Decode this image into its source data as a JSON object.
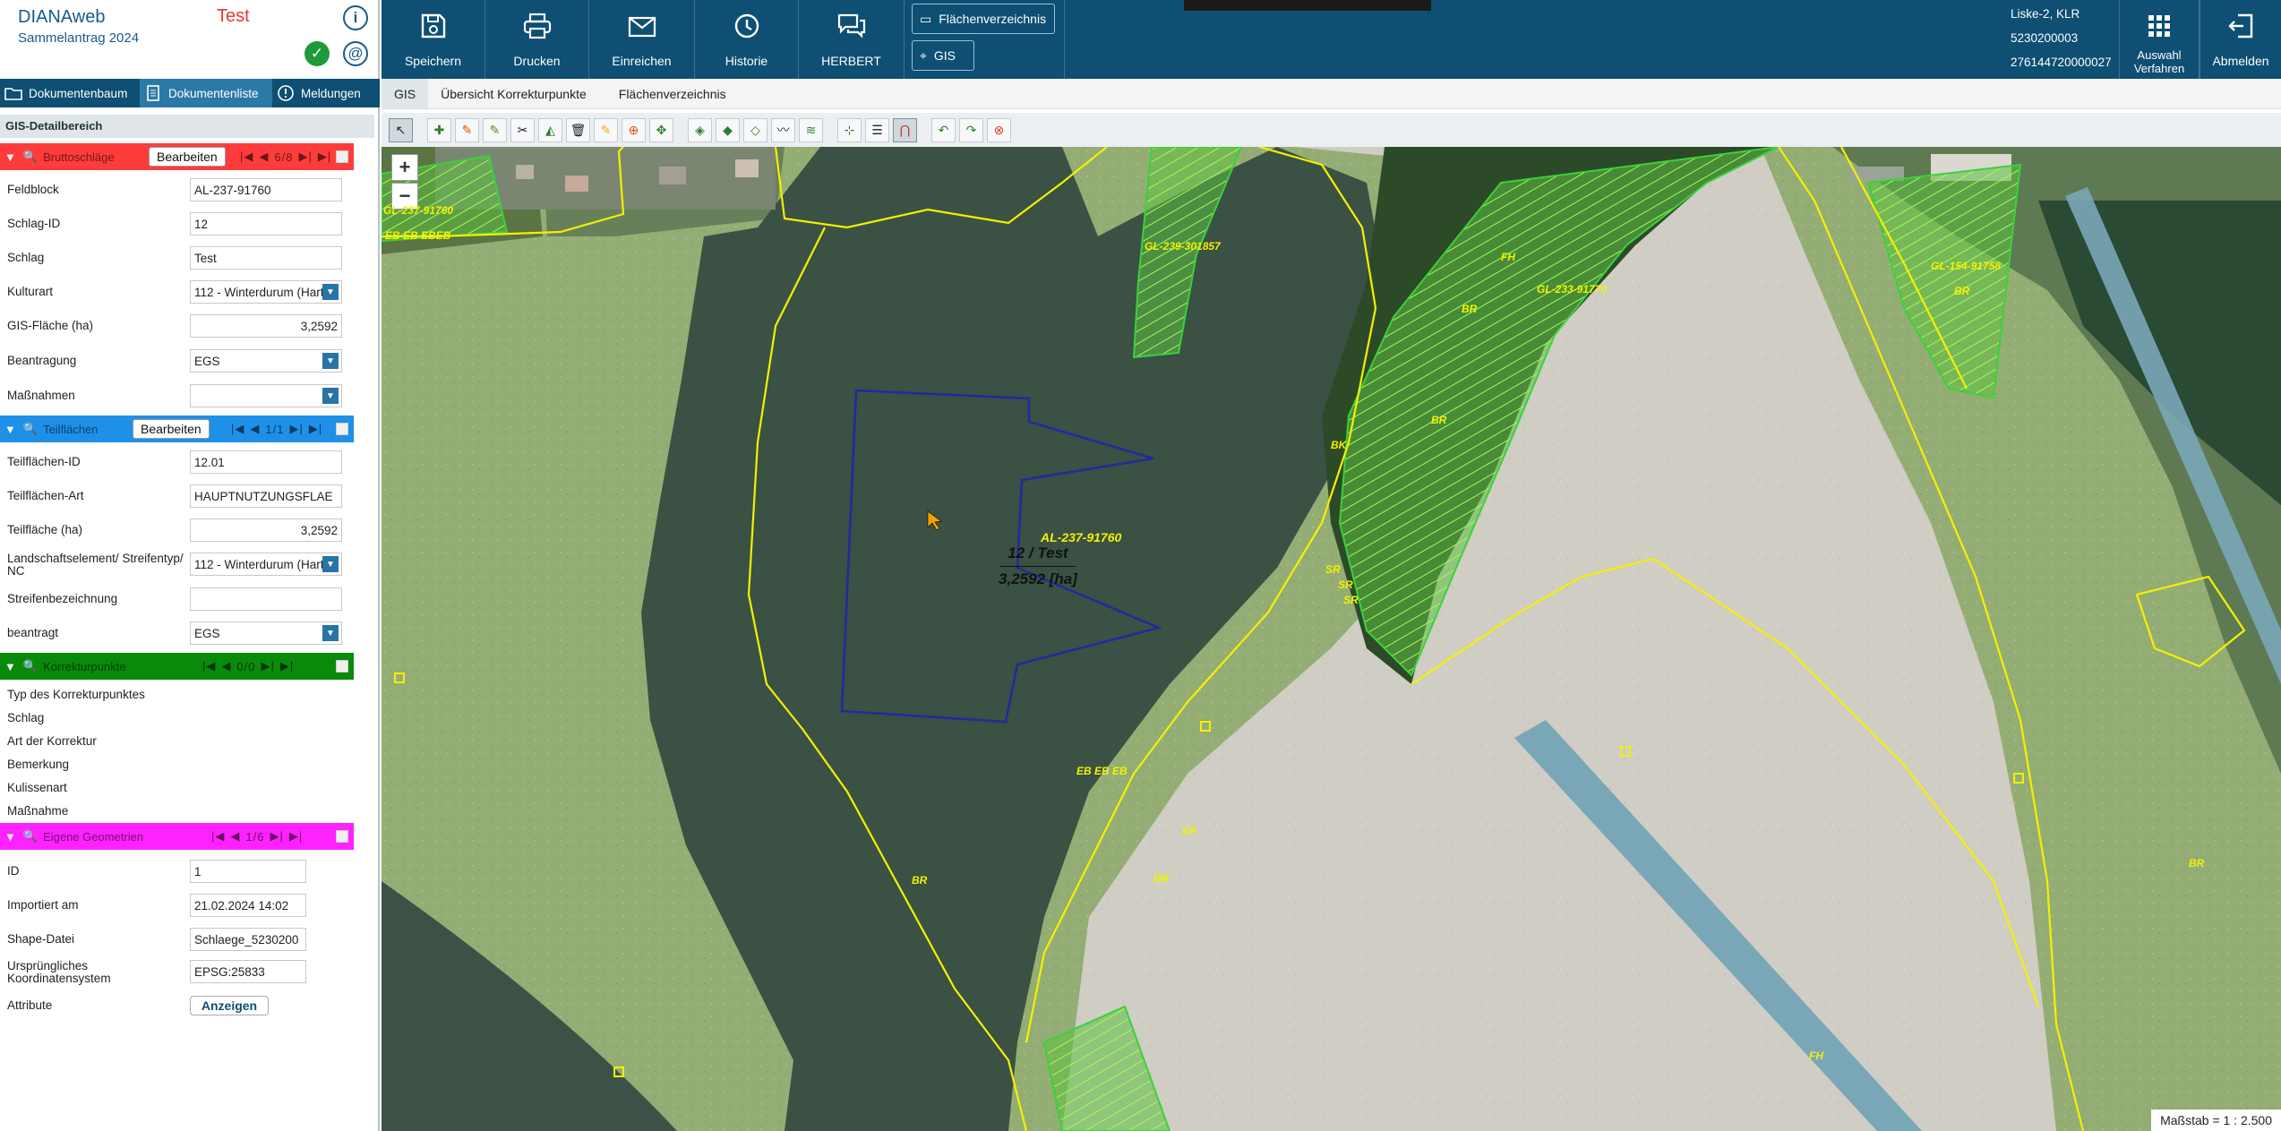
{
  "app": {
    "name": "DIANAweb",
    "subtitle": "Sammelantrag 2024",
    "status_text": "Test"
  },
  "left_tabs": [
    {
      "label": "Dokumentenbaum",
      "icon": "folder-icon"
    },
    {
      "label": "Dokumentenliste",
      "icon": "document-list-icon"
    },
    {
      "label": "Meldungen",
      "icon": "alert-icon"
    }
  ],
  "detail_title": "GIS-Detailbereich",
  "brutto": {
    "title": "Bruttoschläge",
    "edit": "Bearbeiten",
    "nav": "6/8",
    "color": "#ff3c3c",
    "fields": [
      {
        "label": "Feldblock",
        "value": "AL-237-91760"
      },
      {
        "label": "Schlag-ID",
        "value": "12"
      },
      {
        "label": "Schlag",
        "value": "Test"
      },
      {
        "label": "Kulturart",
        "value": "112 - Winterdurum (Hart"
      },
      {
        "label": "GIS-Fläche (ha)",
        "value": "3,2592"
      },
      {
        "label": "Beantragung",
        "value": "EGS"
      },
      {
        "label": "Maßnahmen",
        "value": ""
      }
    ]
  },
  "teil": {
    "title": "Teilflächen",
    "edit": "Bearbeiten",
    "nav": "1/1",
    "color": "#1e90e8",
    "fields": [
      {
        "label": "Teilflächen-ID",
        "value": "12.01"
      },
      {
        "label": "Teilflächen-Art",
        "value": "HAUPTNUTZUNGSFLAE"
      },
      {
        "label": "Teilfläche (ha)",
        "value": "3,2592"
      },
      {
        "label": "Landschaftselement/ Streifentyp/ NC",
        "value": "112 - Winterdurum (Hart"
      },
      {
        "label": "Streifenbezeichnung",
        "value": ""
      },
      {
        "label": "beantragt",
        "value": "EGS"
      }
    ]
  },
  "korr": {
    "title": "Korrekturpunkte",
    "nav": "0/0",
    "color": "#0a8a0a",
    "fields": [
      "Typ des Korrekturpunktes",
      "Schlag",
      "Art der Korrektur",
      "Bemerkung",
      "Kulissenart",
      "Maßnahme"
    ]
  },
  "eigene": {
    "title": "Eigene Geometrien",
    "nav": "1/6",
    "color": "#ff22ff",
    "fields": [
      {
        "label": "ID",
        "value": "1"
      },
      {
        "label": "Importiert am",
        "value": "21.02.2024 14:02"
      },
      {
        "label": "Shape-Datei",
        "value": "Schlaege_5230200"
      },
      {
        "label": "Ursprüngliches Koordinatensystem",
        "value": "EPSG:25833"
      },
      {
        "label": "Attribute",
        "value": "Anzeigen"
      }
    ]
  },
  "toolbar": {
    "save": "Speichern",
    "print": "Drucken",
    "submit": "Einreichen",
    "history": "Historie",
    "herbert": "HERBERT",
    "fv": "Flächenverzeichnis",
    "gis": "GIS",
    "auswahl_1": "Auswahl",
    "auswahl_2": "Verfahren",
    "logout": "Abmelden"
  },
  "user": {
    "name": "Liske-2, KLR",
    "id1": "5230200003",
    "id2": "276144720000027"
  },
  "gis_tabs": [
    "GIS",
    "Übersicht Korrekturpunkte",
    "Flächenverzeichnis"
  ],
  "map": {
    "label_schlag": "12 / Test",
    "label_area": "3,2592 [ha]",
    "scale": "Maßstab = 1 : 2.500",
    "labels": [
      "AL-237-91760",
      "GL-239-301857",
      "GL-233-91770",
      "GL-154-91758",
      "GL-237-91760",
      "FH",
      "BR",
      "BR",
      "SR",
      "SR",
      "SR",
      "BR",
      "BR",
      "BK",
      "BR",
      "FH",
      "EB EB EBEB",
      "EB EB EB",
      "SR",
      "BR"
    ]
  },
  "colors": {
    "brand": "#0e4f73",
    "red": "#e53935"
  }
}
